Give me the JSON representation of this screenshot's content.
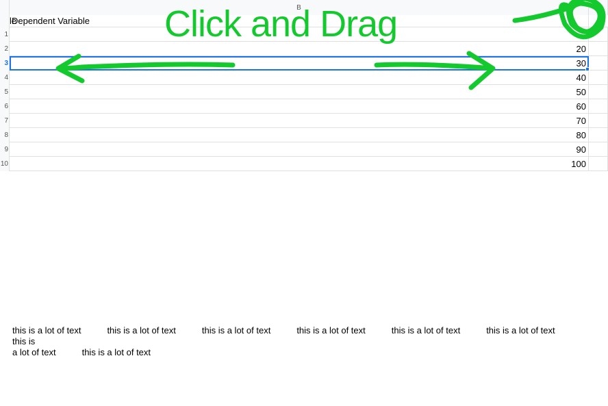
{
  "columns": {
    "a_label": "",
    "b_label": "B",
    "c_label": ""
  },
  "header_row": {
    "a_fragment": "le",
    "b_label": "Dependent Variable"
  },
  "rows": [
    {
      "num": "1",
      "b_value": ""
    },
    {
      "num": "2",
      "b_value": "20"
    },
    {
      "num": "3",
      "b_value": "30"
    },
    {
      "num": "4",
      "b_value": "40"
    },
    {
      "num": "5",
      "b_value": "50"
    },
    {
      "num": "6",
      "b_value": "60"
    },
    {
      "num": "7",
      "b_value": "70"
    },
    {
      "num": "8",
      "b_value": "80"
    },
    {
      "num": "9",
      "b_value": "90"
    },
    {
      "num": "10",
      "b_value": "100"
    }
  ],
  "selected_row_index": 2,
  "long_text": {
    "repeat": "this is a lot of text"
  },
  "annotation": {
    "label": "Click and Drag",
    "color": "#14c92e"
  }
}
